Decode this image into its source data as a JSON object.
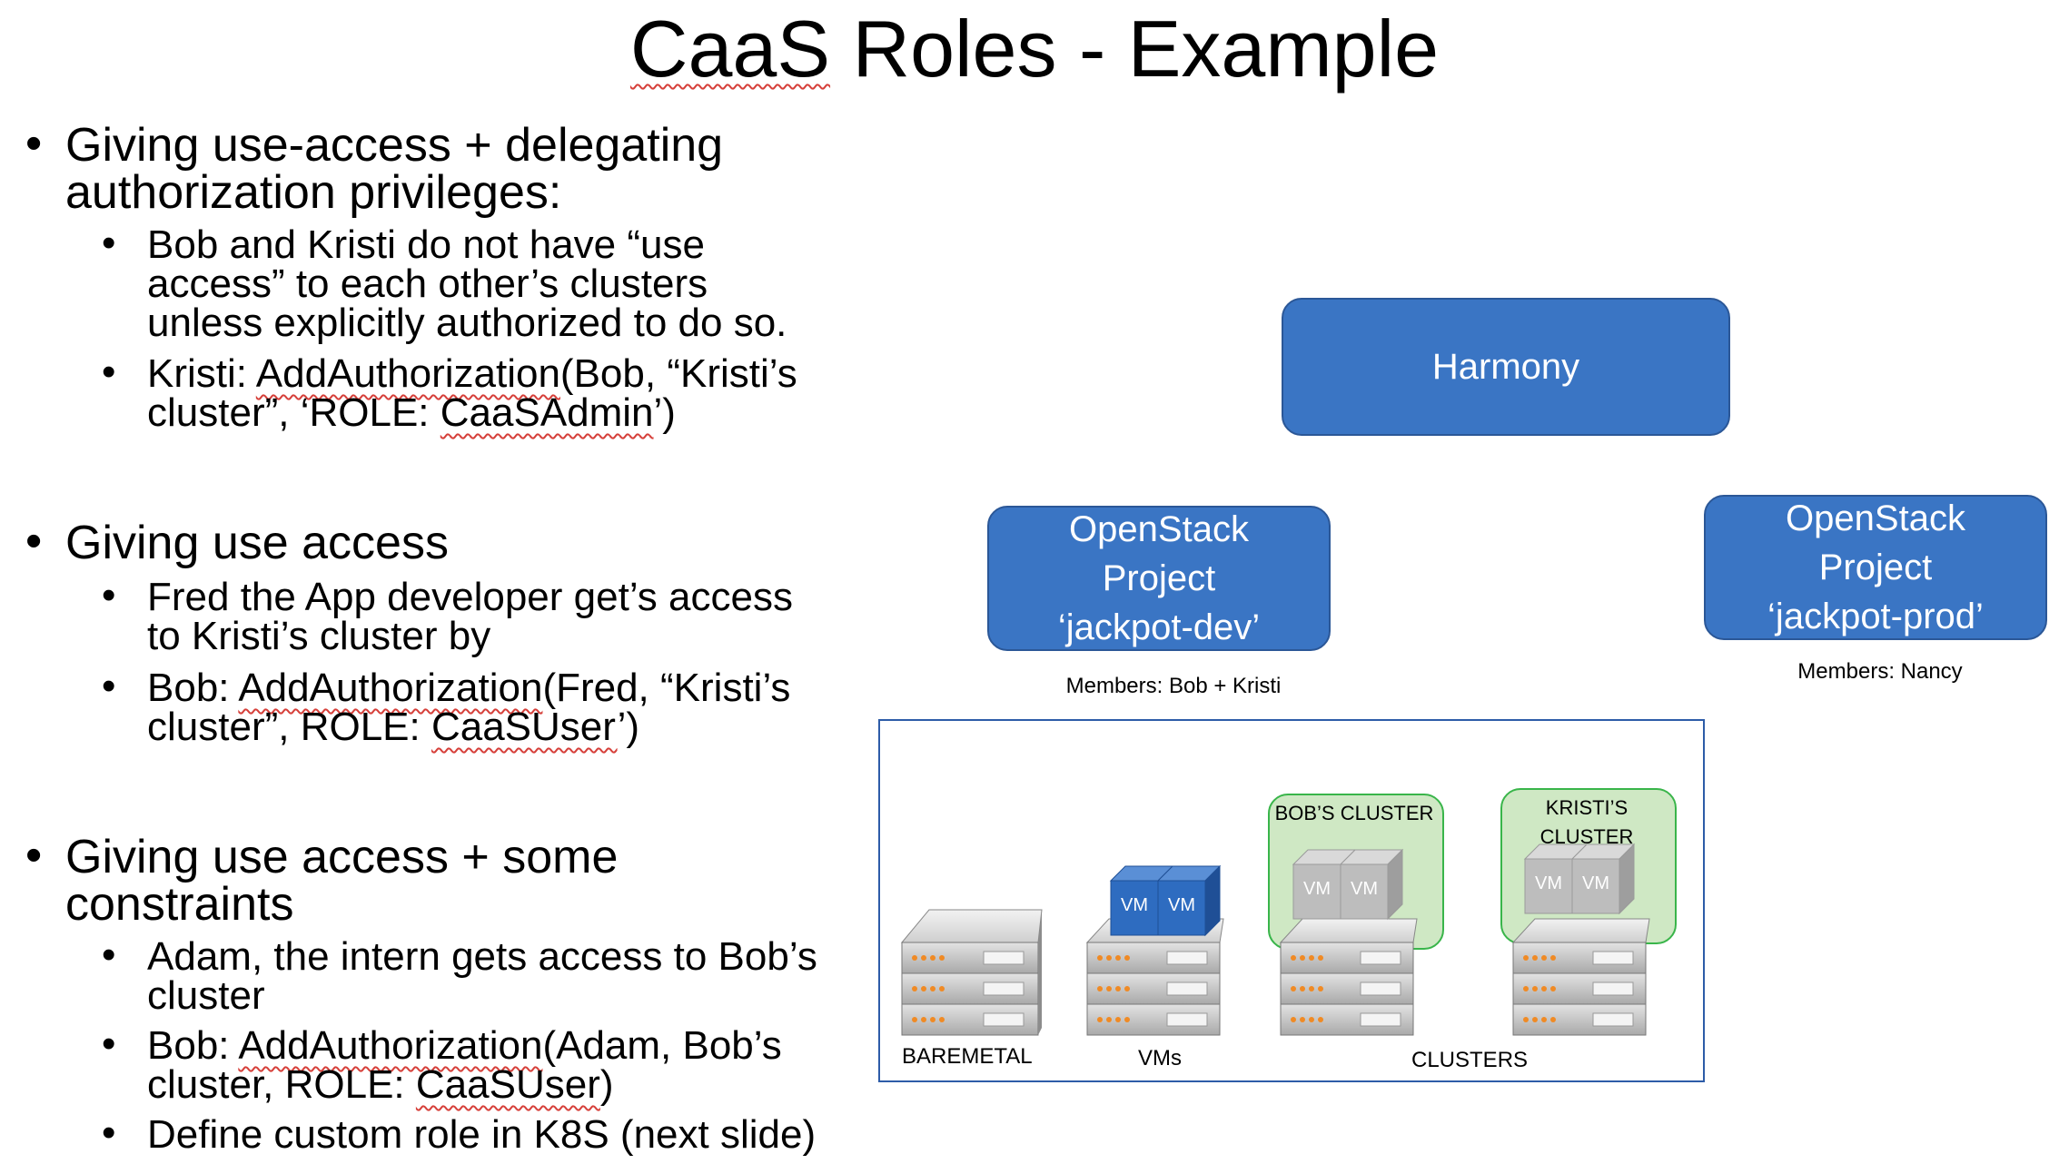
{
  "slide": {
    "title_part1": "CaaS",
    "title_part2": " Roles - Example"
  },
  "bullets": [
    {
      "heading_lines": [
        "Giving use-access + delegating",
        "authorization privileges:"
      ],
      "items": [
        {
          "lines": [
            "Bob and Kristi do not have “use",
            "access” to each other’s clusters",
            "unless explicitly authorized to do so."
          ]
        },
        {
          "line1_prefix": "Kristi: ",
          "line1_fn": "AddAuthorization",
          "line1_rest": "(Bob, “Kristi’s",
          "line2_prefix": "cluster”, ‘ROLE: ",
          "line2_role": "CaaSAdmin",
          "line2_suffix": "’)"
        }
      ]
    },
    {
      "heading_lines": [
        "Giving use access"
      ],
      "items": [
        {
          "lines": [
            "Fred the App developer get’s access",
            "to Kristi’s cluster by"
          ]
        },
        {
          "line1_prefix": "Bob: ",
          "line1_fn": "AddAuthorization",
          "line1_rest": "(Fred, “Kristi’s",
          "line2_prefix": "cluster”, ROLE: ",
          "line2_role": "CaaSUser",
          "line2_suffix": "’)"
        }
      ]
    },
    {
      "heading_lines": [
        "Giving use access + some",
        "constraints"
      ],
      "items": [
        {
          "lines": [
            "Adam, the intern gets access to Bob’s",
            "cluster"
          ]
        },
        {
          "line1_prefix": "Bob: ",
          "line1_fn": "AddAuthorization",
          "line1_rest": "(Adam, Bob’s",
          "line2_prefix": "cluster, ROLE: ",
          "line2_role": "CaaSUser",
          "line2_suffix": ")"
        },
        {
          "lines": [
            "Define custom role in K8S (next slide)"
          ]
        }
      ]
    }
  ],
  "diagram": {
    "harmony": "Harmony",
    "dev_project": [
      "OpenStack",
      "Project",
      "‘jackpot-dev’"
    ],
    "prod_project": [
      "OpenStack",
      "Project",
      "‘jackpot-prod’"
    ],
    "dev_members": "Members: Bob + Kristi",
    "prod_members": "Members: Nancy",
    "bobs_cluster": [
      "BOB’S CLUSTER"
    ],
    "kristis_cluster": [
      "KRISTI’S",
      "CLUSTER"
    ],
    "vm_label": "VM",
    "captions": {
      "baremetal": "BAREMETAL",
      "vms": "VMs",
      "clusters": "CLUSTERS"
    },
    "colors": {
      "box_blue": "#3a75c4",
      "cluster_green": "#cfe8c4",
      "cluster_border": "#39b54a",
      "vm_blue": "#2e6cc0",
      "vm_grey": "#bdbdbd"
    }
  }
}
